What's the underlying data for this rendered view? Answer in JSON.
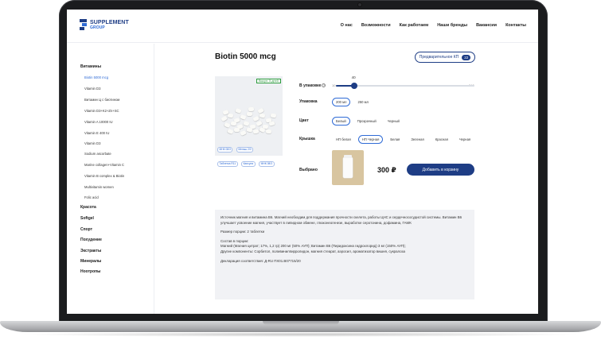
{
  "header": {
    "logo_line1": "SUPPLEMENT",
    "logo_line2": "GROUP",
    "nav": [
      "О нас",
      "Возможности",
      "Как работаем",
      "Наши бренды",
      "Вакансии",
      "Контакты"
    ]
  },
  "sidebar": {
    "categories": [
      {
        "label": "Витамины",
        "subitems": [
          "Biotin 5000 mcg",
          "Vitamin D3",
          "Витамин Ц с биотином",
          "Vitamin D3+K2+Zn+SC",
          "Vitamin A 10000 IU",
          "Vitamin E 400 IU",
          "Vitamin D3",
          "Sodium ascorbate",
          "Marine collagen+Vitamin C",
          "Vitamin B complex & Biotin",
          "Multivitamin women",
          "Folic acid"
        ]
      },
      {
        "label": "Красота"
      },
      {
        "label": "Softgel"
      },
      {
        "label": "Спорт"
      },
      {
        "label": "Похудение"
      },
      {
        "label": "Экстракты"
      },
      {
        "label": "Минералы"
      },
      {
        "label": "Ноотропы"
      }
    ],
    "active_subitem": "Biotin 5000 mcg"
  },
  "product": {
    "title": "Biotin 5000 mcg",
    "kp_button": "Предварительное КП",
    "kp_count": "22",
    "badge": "Выкуп: 5 дней",
    "image_tags": [
      "МНК 08/3",
      "Меньш 2/0",
      "Таблетка R11",
      "Капсула",
      "МНК 08/3"
    ],
    "price": "300 ₽",
    "cart_button": "Добавить в корзину"
  },
  "options": {
    "quantity": {
      "label": "В упаковке",
      "info": "?",
      "min": "10",
      "max": "240",
      "value": "40",
      "fraction": 0.13
    },
    "packing": {
      "label": "Упаковка",
      "choices": [
        "200 мл",
        "250 мл"
      ],
      "selected": 0
    },
    "color": {
      "label": "Цвет",
      "choices": [
        "Белый",
        "Прозрачный",
        "Черный"
      ],
      "selected": 0
    },
    "cap": {
      "label": "Крышка",
      "choices": [
        "НП белая",
        "НП Черная",
        "Белая",
        "Зеленая",
        "Красная",
        "Черная"
      ],
      "selected": 1
    },
    "chosen": {
      "label": "Выбрано"
    }
  },
  "description": {
    "p1": "Источник магния и витамина B6. Магний необходим для поддержания прочности скелета, работы ЦНС и сердечнососудистой системы. Витамин B6 улучшает усвоение магния, участвует в липидном обмене, глюконеогенезе, выработке серотонина, дофамина, ГАМК",
    "p2": "Размер порции: 2 таблетки",
    "p3": "Состав в порции:",
    "p4": "Магний (Магния цитрат; 17%, 1,2 гр) 200 мг (50% АУП); Витамин В6 (Пиридоксина гидрохлорид) 3 мг (150% АУП);",
    "p5": "Другие компоненты: Сорбитол, поливинилпирролидон, магния стеарат, аэросил, ароматизатор вишня, сукралоза",
    "p6": "Декларация соответствия: Д-RU ПХ01.В07715/20"
  },
  "colors": {
    "brand": "#1e3d85",
    "accent": "#2f6bd6",
    "badge_green": "#2a9a3c"
  }
}
